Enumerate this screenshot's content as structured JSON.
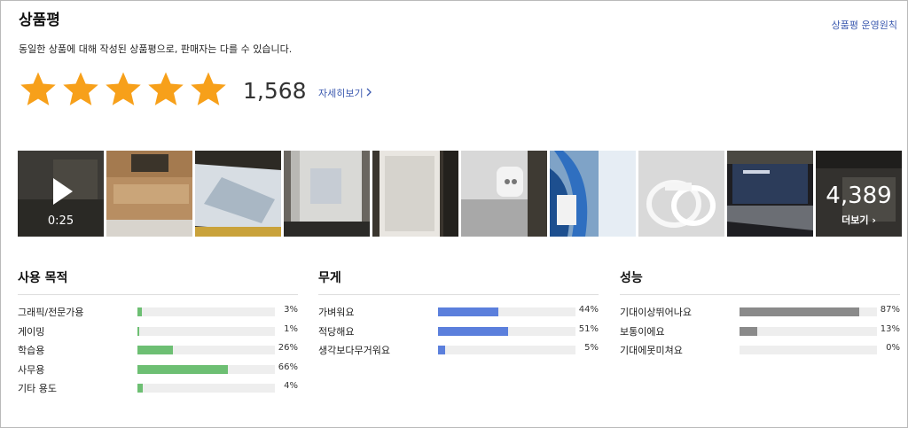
{
  "header": {
    "title": "상품평",
    "policy_link": "상품평 운영원칙",
    "description": "동일한 상품에 대해 작성된 상품평으로, 판매자는 다를 수 있습니다."
  },
  "rating": {
    "stars": 5,
    "review_count": "1,568",
    "more_link": "자세히보기",
    "star_color": "#f7a01a"
  },
  "gallery": {
    "video_duration": "0:25",
    "photo_count": "4,389",
    "more_label": "더보기"
  },
  "sections": [
    {
      "title": "사용 목적",
      "color": "#6dbf73",
      "items": [
        {
          "label": "그래픽/전문가용",
          "pct_text": "3%",
          "value": 3
        },
        {
          "label": "게이밍",
          "pct_text": "1%",
          "value": 1
        },
        {
          "label": "학습용",
          "pct_text": "26%",
          "value": 26
        },
        {
          "label": "사무용",
          "pct_text": "66%",
          "value": 66
        },
        {
          "label": "기타 용도",
          "pct_text": "4%",
          "value": 4
        }
      ]
    },
    {
      "title": "무게",
      "color": "#5b7fdc",
      "items": [
        {
          "label": "가벼워요",
          "pct_text": "44%",
          "value": 44
        },
        {
          "label": "적당해요",
          "pct_text": "51%",
          "value": 51
        },
        {
          "label": "생각보다무거워요",
          "pct_text": "5%",
          "value": 5
        }
      ]
    },
    {
      "title": "성능",
      "color": "#8a8a8a",
      "items": [
        {
          "label": "기대이상뛰어나요",
          "pct_text": "87%",
          "value": 87
        },
        {
          "label": "보통이에요",
          "pct_text": "13%",
          "value": 13
        },
        {
          "label": "기대에못미쳐요",
          "pct_text": "0%",
          "value": 0
        }
      ]
    }
  ]
}
